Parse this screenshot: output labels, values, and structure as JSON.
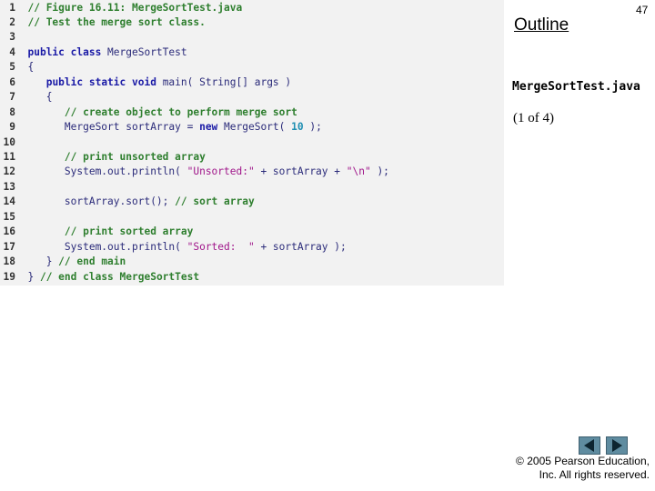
{
  "code_listing": {
    "lines": [
      {
        "n": "1",
        "seg": [
          {
            "c": "cm",
            "t": "// Figure 16.11: MergeSortTest.java"
          }
        ]
      },
      {
        "n": "2",
        "seg": [
          {
            "c": "cm",
            "t": "// Test the merge sort class."
          }
        ]
      },
      {
        "n": "3",
        "seg": []
      },
      {
        "n": "4",
        "seg": [
          {
            "c": "kw",
            "t": "public class"
          },
          {
            "c": "code",
            "t": " MergeSortTest"
          }
        ]
      },
      {
        "n": "5",
        "seg": [
          {
            "c": "code",
            "t": "{"
          }
        ]
      },
      {
        "n": "6",
        "seg": [
          {
            "c": "code",
            "t": "   "
          },
          {
            "c": "kw",
            "t": "public static void"
          },
          {
            "c": "code",
            "t": " main( String[] args )"
          }
        ]
      },
      {
        "n": "7",
        "seg": [
          {
            "c": "code",
            "t": "   {"
          }
        ]
      },
      {
        "n": "8",
        "seg": [
          {
            "c": "code",
            "t": "      "
          },
          {
            "c": "cm",
            "t": "// create object to perform merge sort"
          }
        ]
      },
      {
        "n": "9",
        "seg": [
          {
            "c": "code",
            "t": "      MergeSort sortArray = "
          },
          {
            "c": "kw",
            "t": "new"
          },
          {
            "c": "code",
            "t": " MergeSort( "
          },
          {
            "c": "num",
            "t": "10"
          },
          {
            "c": "code",
            "t": " );"
          }
        ]
      },
      {
        "n": "10",
        "seg": []
      },
      {
        "n": "11",
        "seg": [
          {
            "c": "code",
            "t": "      "
          },
          {
            "c": "cm",
            "t": "// print unsorted array"
          }
        ]
      },
      {
        "n": "12",
        "seg": [
          {
            "c": "code",
            "t": "      System.out.println( "
          },
          {
            "c": "str",
            "t": "\"Unsorted:\""
          },
          {
            "c": "code",
            "t": " + sortArray + "
          },
          {
            "c": "str",
            "t": "\"\\n\""
          },
          {
            "c": "code",
            "t": " );"
          }
        ]
      },
      {
        "n": "13",
        "seg": []
      },
      {
        "n": "14",
        "seg": [
          {
            "c": "code",
            "t": "      sortArray.sort(); "
          },
          {
            "c": "cm",
            "t": "// sort array"
          }
        ]
      },
      {
        "n": "15",
        "seg": []
      },
      {
        "n": "16",
        "seg": [
          {
            "c": "code",
            "t": "      "
          },
          {
            "c": "cm",
            "t": "// print sorted array"
          }
        ]
      },
      {
        "n": "17",
        "seg": [
          {
            "c": "code",
            "t": "      System.out.println( "
          },
          {
            "c": "str",
            "t": "\"Sorted:  \""
          },
          {
            "c": "code",
            "t": " + sortArray );"
          }
        ]
      },
      {
        "n": "18",
        "seg": [
          {
            "c": "code",
            "t": "   } "
          },
          {
            "c": "cm",
            "t": "// end main"
          }
        ]
      },
      {
        "n": "19",
        "seg": [
          {
            "c": "code",
            "t": "} "
          },
          {
            "c": "cm",
            "t": "// end class MergeSortTest"
          }
        ]
      }
    ]
  },
  "sidebar": {
    "outline_title": "Outline",
    "page_number": "47",
    "file_name": "MergeSortTest.java",
    "part_label": "(1 of 4)"
  },
  "navigation": {
    "prev_icon": "triangle-left-icon",
    "next_icon": "triangle-right-icon",
    "button_color": "#5f8ca0"
  },
  "footer": {
    "copyright_line1": "© 2005 Pearson Education,",
    "copyright_line2": "Inc.  All rights reserved."
  }
}
